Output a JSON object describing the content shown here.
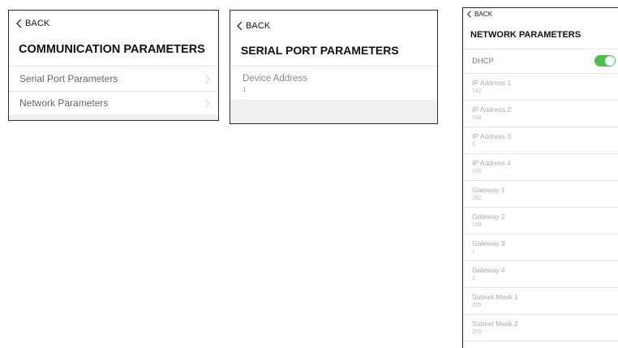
{
  "screen1": {
    "back_label": "BACK",
    "title": "COMMUNICATION PARAMETERS",
    "items": [
      {
        "label": "Serial Port Parameters"
      },
      {
        "label": "Network Parameters"
      }
    ]
  },
  "screen2": {
    "back_label": "BACK",
    "title": "SERIAL PORT PARAMETERS",
    "field": {
      "label": "Device Address",
      "value": "1"
    }
  },
  "screen3": {
    "back_label": "BACK",
    "title": "NETWORK PARAMETERS",
    "dhcp": {
      "label": "DHCP",
      "enabled": true,
      "color": "#4cc04c"
    },
    "fields": [
      {
        "label": "IP Address 1",
        "value": "192"
      },
      {
        "label": "IP Address 2",
        "value": "168"
      },
      {
        "label": "IP Address 3",
        "value": "1"
      },
      {
        "label": "IP Address 4",
        "value": "100"
      },
      {
        "label": "Gateway 1",
        "value": "192"
      },
      {
        "label": "Gateway 2",
        "value": "168"
      },
      {
        "label": "Gateway 3",
        "value": "1"
      },
      {
        "label": "Gateway 4",
        "value": "1"
      },
      {
        "label": "Subnet Mask 1",
        "value": "255"
      },
      {
        "label": "Subnet Mask 2",
        "value": "255"
      }
    ]
  }
}
